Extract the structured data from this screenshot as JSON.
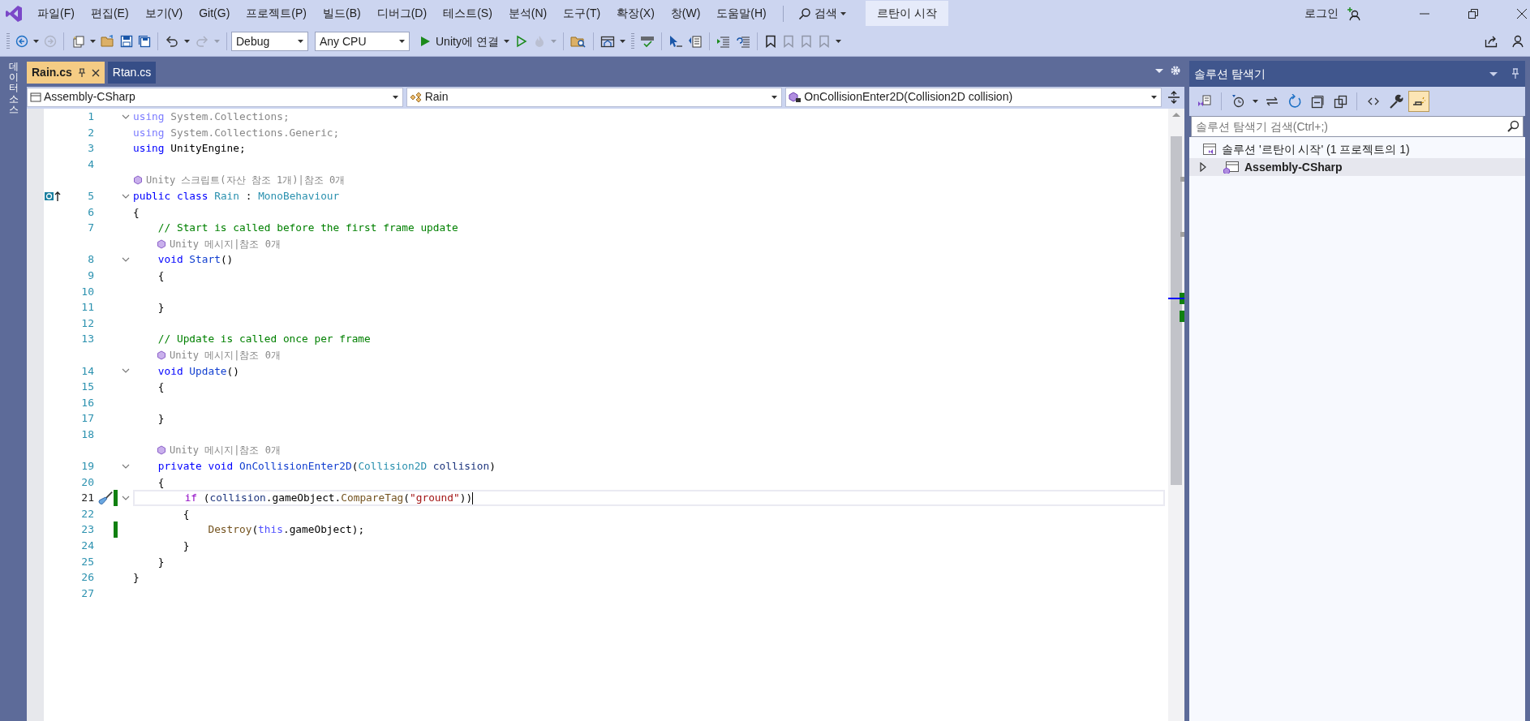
{
  "menu": [
    {
      "label": "파일(F)"
    },
    {
      "label": "편집(E)"
    },
    {
      "label": "보기(V)"
    },
    {
      "label": "Git(G)"
    },
    {
      "label": "프로젝트(P)"
    },
    {
      "label": "빌드(B)"
    },
    {
      "label": "디버그(D)"
    },
    {
      "label": "테스트(S)"
    },
    {
      "label": "분석(N)"
    },
    {
      "label": "도구(T)"
    },
    {
      "label": "확장(X)"
    },
    {
      "label": "창(W)"
    },
    {
      "label": "도움말(H)"
    }
  ],
  "search": {
    "label": "검색"
  },
  "solution_title": "르탄이 시작",
  "login": "로그인",
  "toolbar": [
    {
      "kind": "grip"
    },
    {
      "kind": "back",
      "disabled": false
    },
    {
      "kind": "caret",
      "disabled": false
    },
    {
      "kind": "forward",
      "disabled": true
    },
    {
      "kind": "sep"
    },
    {
      "kind": "new-item",
      "disabled": false
    },
    {
      "kind": "caret",
      "disabled": false
    },
    {
      "kind": "open-folder",
      "disabled": false
    },
    {
      "kind": "save",
      "disabled": false
    },
    {
      "kind": "save-all",
      "disabled": false
    },
    {
      "kind": "sep"
    },
    {
      "kind": "undo",
      "disabled": false
    },
    {
      "kind": "caret",
      "disabled": false
    },
    {
      "kind": "redo",
      "disabled": true
    },
    {
      "kind": "caret",
      "disabled": true
    },
    {
      "kind": "sep"
    },
    {
      "kind": "select",
      "value": "Debug"
    },
    {
      "kind": "select",
      "value": "Any CPU"
    },
    {
      "kind": "run",
      "label": "Unity에 연결"
    },
    {
      "kind": "play-outline",
      "disabled": false
    },
    {
      "kind": "flame",
      "disabled": true
    },
    {
      "kind": "caret",
      "disabled": true
    },
    {
      "kind": "sep"
    },
    {
      "kind": "folder-search",
      "disabled": false
    },
    {
      "kind": "sep"
    },
    {
      "kind": "window",
      "disabled": false
    },
    {
      "kind": "caret",
      "disabled": false
    },
    {
      "kind": "grip"
    },
    {
      "kind": "spell",
      "disabled": false
    },
    {
      "kind": "sep"
    },
    {
      "kind": "cursor",
      "disabled": false
    },
    {
      "kind": "columns",
      "disabled": false
    },
    {
      "kind": "sep"
    },
    {
      "kind": "lines",
      "disabled": false
    },
    {
      "kind": "lines-undo",
      "disabled": false
    },
    {
      "kind": "sep"
    },
    {
      "kind": "bookmark",
      "disabled": false
    },
    {
      "kind": "bookmark",
      "disabled": true
    },
    {
      "kind": "bookmark",
      "disabled": true
    },
    {
      "kind": "bookmark",
      "disabled": true
    },
    {
      "kind": "caret",
      "disabled": false
    }
  ],
  "side_strip": "데이터 소스",
  "tabs": [
    {
      "label": "Rain.cs",
      "selected": true
    },
    {
      "label": "Rtan.cs",
      "selected": false
    }
  ],
  "navbar": [
    {
      "kind": "project",
      "text": "Assembly-CSharp"
    },
    {
      "kind": "class",
      "text": "Rain"
    },
    {
      "kind": "method",
      "text": "OnCollisionEnter2D(Collision2D collision)"
    }
  ],
  "lines": [
    {
      "kind": "code",
      "number": "1",
      "fold": true,
      "changed": false,
      "current": false,
      "override": false,
      "quick_fix": false,
      "tokens": [
        {
          "text": "using",
          "kind": "kw-dim"
        },
        {
          "text": " System.Collections;",
          "kind": "dim"
        }
      ]
    },
    {
      "kind": "code",
      "number": "2",
      "fold": false,
      "changed": false,
      "current": false,
      "override": false,
      "quick_fix": false,
      "tokens": [
        {
          "text": "using",
          "kind": "kw-dim"
        },
        {
          "text": " System.Collections.Generic;",
          "kind": "dim"
        }
      ]
    },
    {
      "kind": "code",
      "number": "3",
      "fold": false,
      "changed": false,
      "current": false,
      "override": false,
      "quick_fix": false,
      "tokens": [
        {
          "text": "using",
          "kind": "kw"
        },
        {
          "text": " UnityEngine;",
          "kind": "plain"
        }
      ]
    },
    {
      "kind": "code",
      "number": "4",
      "fold": false,
      "changed": false,
      "current": false,
      "override": false,
      "quick_fix": false
    },
    {
      "kind": "codelens",
      "text": "Unity 스크립트(자산 참조 1개)|참조 0개"
    },
    {
      "kind": "code",
      "number": "5",
      "fold": true,
      "changed": false,
      "current": false,
      "override": true,
      "quick_fix": false,
      "tokens": [
        {
          "text": "public class ",
          "kind": "kw"
        },
        {
          "text": "Rain",
          "kind": "type"
        },
        {
          "text": " : ",
          "kind": "plain"
        },
        {
          "text": "MonoBehaviour",
          "kind": "type"
        }
      ]
    },
    {
      "kind": "code",
      "number": "6",
      "fold": false,
      "changed": false,
      "current": false,
      "override": false,
      "quick_fix": false,
      "tokens": [
        {
          "text": "{",
          "kind": "plain"
        }
      ]
    },
    {
      "kind": "code",
      "number": "7",
      "fold": false,
      "changed": false,
      "current": false,
      "override": false,
      "quick_fix": false,
      "tokens": [
        {
          "text": "    // Start is called before the first frame update",
          "kind": "comment"
        }
      ]
    },
    {
      "kind": "codelens",
      "text": "Unity 메시지|참조 0개"
    },
    {
      "kind": "code",
      "number": "8",
      "fold": true,
      "changed": false,
      "current": false,
      "override": false,
      "quick_fix": false,
      "tokens": [
        {
          "text": "    void ",
          "kind": "kw"
        },
        {
          "text": "Start",
          "kind": "unity"
        },
        {
          "text": "()",
          "kind": "plain"
        }
      ]
    },
    {
      "kind": "code",
      "number": "9",
      "fold": false,
      "changed": false,
      "current": false,
      "override": false,
      "quick_fix": false,
      "tokens": [
        {
          "text": "    {",
          "kind": "plain"
        }
      ]
    },
    {
      "kind": "code",
      "number": "10",
      "fold": false,
      "changed": false,
      "current": false,
      "override": false,
      "quick_fix": false
    },
    {
      "kind": "code",
      "number": "11",
      "fold": false,
      "changed": false,
      "current": false,
      "override": false,
      "quick_fix": false,
      "tokens": [
        {
          "text": "    }",
          "kind": "plain"
        }
      ]
    },
    {
      "kind": "code",
      "number": "12",
      "fold": false,
      "changed": false,
      "current": false,
      "override": false,
      "quick_fix": false
    },
    {
      "kind": "code",
      "number": "13",
      "fold": false,
      "changed": false,
      "current": false,
      "override": false,
      "quick_fix": false,
      "tokens": [
        {
          "text": "    // Update is called once per frame",
          "kind": "comment"
        }
      ]
    },
    {
      "kind": "codelens",
      "text": "Unity 메시지|참조 0개"
    },
    {
      "kind": "code",
      "number": "14",
      "fold": true,
      "changed": false,
      "current": false,
      "override": false,
      "quick_fix": false,
      "tokens": [
        {
          "text": "    void ",
          "kind": "kw"
        },
        {
          "text": "Update",
          "kind": "unity"
        },
        {
          "text": "()",
          "kind": "plain"
        }
      ]
    },
    {
      "kind": "code",
      "number": "15",
      "fold": false,
      "changed": false,
      "current": false,
      "override": false,
      "quick_fix": false,
      "tokens": [
        {
          "text": "    {",
          "kind": "plain"
        }
      ]
    },
    {
      "kind": "code",
      "number": "16",
      "fold": false,
      "changed": false,
      "current": false,
      "override": false,
      "quick_fix": false
    },
    {
      "kind": "code",
      "number": "17",
      "fold": false,
      "changed": false,
      "current": false,
      "override": false,
      "quick_fix": false,
      "tokens": [
        {
          "text": "    }",
          "kind": "plain"
        }
      ]
    },
    {
      "kind": "code",
      "number": "18",
      "fold": false,
      "changed": false,
      "current": false,
      "override": false,
      "quick_fix": false
    },
    {
      "kind": "codelens",
      "text": "Unity 메시지|참조 0개"
    },
    {
      "kind": "code",
      "number": "19",
      "fold": true,
      "changed": false,
      "current": false,
      "override": false,
      "quick_fix": false,
      "tokens": [
        {
          "text": "    private void ",
          "kind": "kw"
        },
        {
          "text": "OnCollisionEnter2D",
          "kind": "unity"
        },
        {
          "text": "(",
          "kind": "plain"
        },
        {
          "text": "Collision2D",
          "kind": "type"
        },
        {
          "text": " collision",
          "kind": "param"
        },
        {
          "text": ")",
          "kind": "plain"
        }
      ]
    },
    {
      "kind": "code",
      "number": "20",
      "fold": false,
      "changed": false,
      "current": false,
      "override": false,
      "quick_fix": false,
      "tokens": [
        {
          "text": "    {",
          "kind": "plain"
        }
      ]
    },
    {
      "kind": "code",
      "number": "21",
      "fold": true,
      "changed": true,
      "current": true,
      "override": false,
      "quick_fix": true,
      "tokens": [
        {
          "text": "        if ",
          "kind": "control"
        },
        {
          "text": "(",
          "kind": "plain"
        },
        {
          "text": "collision",
          "kind": "param"
        },
        {
          "text": ".gameObject.",
          "kind": "plain"
        },
        {
          "text": "CompareTag",
          "kind": "method"
        },
        {
          "text": "(",
          "kind": "plain"
        },
        {
          "text": "\"ground\"",
          "kind": "string"
        },
        {
          "text": "))",
          "kind": "plain"
        }
      ]
    },
    {
      "kind": "code",
      "number": "22",
      "fold": false,
      "changed": false,
      "current": false,
      "override": false,
      "quick_fix": false,
      "tokens": [
        {
          "text": "        {",
          "kind": "plain"
        }
      ]
    },
    {
      "kind": "code",
      "number": "23",
      "fold": false,
      "changed": true,
      "current": false,
      "override": false,
      "quick_fix": false,
      "tokens": [
        {
          "text": "            Destroy",
          "kind": "method"
        },
        {
          "text": "(",
          "kind": "plain"
        },
        {
          "text": "this",
          "kind": "kw-light"
        },
        {
          "text": ".gameObject);",
          "kind": "plain"
        }
      ]
    },
    {
      "kind": "code",
      "number": "24",
      "fold": false,
      "changed": false,
      "current": false,
      "override": false,
      "quick_fix": false,
      "tokens": [
        {
          "text": "        }",
          "kind": "plain"
        }
      ]
    },
    {
      "kind": "code",
      "number": "25",
      "fold": false,
      "changed": false,
      "current": false,
      "override": false,
      "quick_fix": false,
      "tokens": [
        {
          "text": "    }",
          "kind": "plain"
        }
      ]
    },
    {
      "kind": "code",
      "number": "26",
      "fold": false,
      "changed": false,
      "current": false,
      "override": false,
      "quick_fix": false,
      "tokens": [
        {
          "text": "}",
          "kind": "plain"
        }
      ]
    },
    {
      "kind": "code",
      "number": "27",
      "fold": false,
      "changed": false,
      "current": false,
      "override": false,
      "quick_fix": false
    }
  ],
  "explorer": {
    "title": "솔루션 탐색기",
    "toolbar": [
      {
        "kind": "vs-switch",
        "on": false
      },
      {
        "kind": "sep"
      },
      {
        "kind": "history",
        "on": false
      },
      {
        "kind": "caret",
        "on": false
      },
      {
        "kind": "sync",
        "on": false
      },
      {
        "kind": "refresh",
        "on": false
      },
      {
        "kind": "collapse",
        "on": false
      },
      {
        "kind": "copies",
        "on": false
      },
      {
        "kind": "sep"
      },
      {
        "kind": "code",
        "on": false
      },
      {
        "kind": "wrench",
        "on": false
      },
      {
        "kind": "preview",
        "on": true
      }
    ],
    "search": {
      "placeholder": "솔루션 탐색기 검색(Ctrl+;)"
    },
    "tree": [
      {
        "kind": "solution",
        "label": "솔루션 '르탄이 시작' (1 프로젝트의 1)",
        "selected": false
      },
      {
        "kind": "project",
        "label": "Assembly-CSharp",
        "selected": true,
        "expanded": false
      }
    ]
  }
}
